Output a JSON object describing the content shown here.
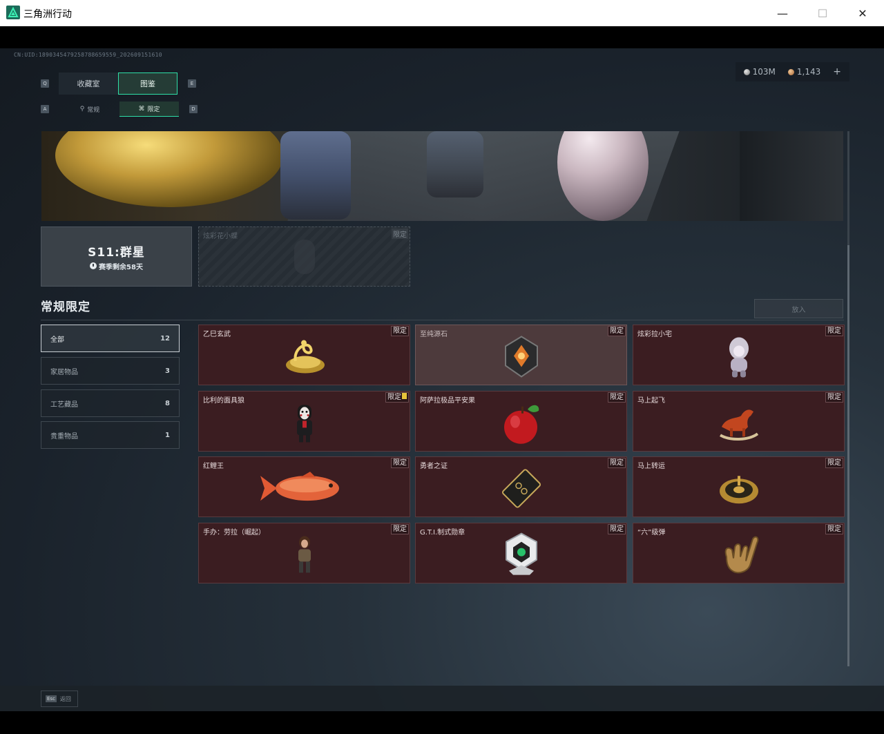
{
  "window": {
    "title": "三角洲行动",
    "min": "—",
    "max": "☐",
    "close": "✕"
  },
  "uid": "CN:UID:1890345479258788659559_202609151610",
  "currency": {
    "silver": "103M",
    "bronze": "1,143",
    "add": "+"
  },
  "tabs": {
    "main": [
      {
        "label": "收藏室",
        "key": "Q"
      },
      {
        "label": "图鉴",
        "key": "E"
      }
    ],
    "sub": [
      {
        "label": "常规",
        "key": "A"
      },
      {
        "label": "限定",
        "key": "D"
      }
    ],
    "main_active": "图鉴",
    "sub_active": "限定"
  },
  "season": {
    "title": "S11:群星",
    "remaining": "赛季剩余58天"
  },
  "locked_card": {
    "name": "炫彩花小蝶",
    "tag": "限定"
  },
  "section": {
    "title": "常规限定",
    "place_button": "放入"
  },
  "filters": [
    {
      "label": "全部",
      "count": "12"
    },
    {
      "label": "家居物品",
      "count": "3"
    },
    {
      "label": "工艺藏品",
      "count": "8"
    },
    {
      "label": "贵重物品",
      "count": "1"
    }
  ],
  "items": [
    {
      "name": "乙巳玄武",
      "tag": "限定",
      "icon": "golden-snake-turtle-icon"
    },
    {
      "name": "至纯源石",
      "tag": "限定",
      "icon": "source-stone-icon"
    },
    {
      "name": "炫彩拉小宅",
      "tag": "限定",
      "icon": "figurine-icon"
    },
    {
      "name": "比利的面具狼",
      "tag": "限定",
      "icon": "billy-puppet-icon"
    },
    {
      "name": "阿萨拉极品平安果",
      "tag": "限定",
      "icon": "apple-icon"
    },
    {
      "name": "马上起飞",
      "tag": "限定",
      "icon": "bronze-horse-icon"
    },
    {
      "name": "红鲤王",
      "tag": "限定",
      "icon": "red-carp-icon"
    },
    {
      "name": "勇者之证",
      "tag": "限定",
      "icon": "card-icon"
    },
    {
      "name": "马上转运",
      "tag": "限定",
      "icon": "compass-icon"
    },
    {
      "name": "手办：劳拉（崛起）",
      "tag": "限定",
      "icon": "lara-figure-icon"
    },
    {
      "name": "G.T.I.制式勋章",
      "tag": "限定",
      "icon": "medal-icon"
    },
    {
      "name": "“六”级弹",
      "tag": "限定",
      "icon": "hand-icon"
    }
  ],
  "footer": {
    "esc_key": "Esc",
    "esc_label": "返回"
  },
  "colors": {
    "accent": "#2fe0a8",
    "card_bg": "#3b1d21"
  }
}
